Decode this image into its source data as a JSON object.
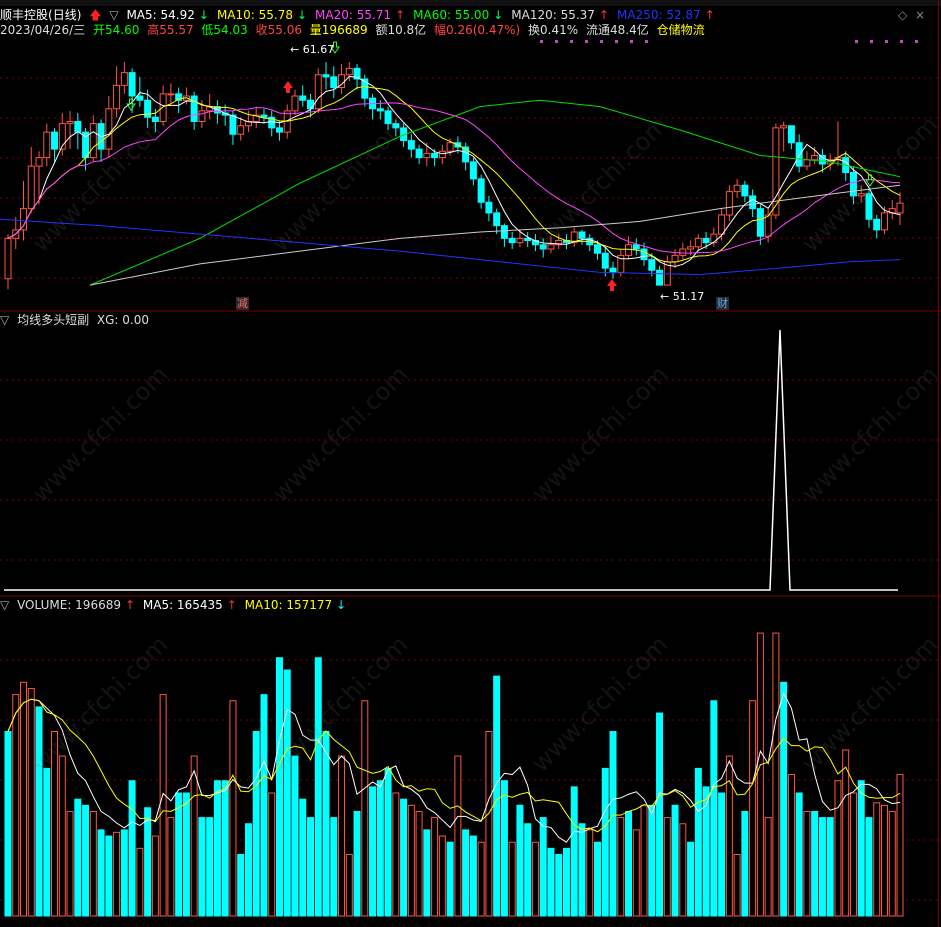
{
  "stock": {
    "name": "顺丰控股",
    "period": "(日线)"
  },
  "ma_line": [
    {
      "label": "MA5: 54.92",
      "arrow": "↓",
      "color": "#ffffff",
      "arrow_color": "#00ff66"
    },
    {
      "label": "MA10: 55.78",
      "arrow": "↓",
      "color": "#ffff00",
      "arrow_color": "#00ff66"
    },
    {
      "label": "MA20: 55.71",
      "arrow": "↑",
      "color": "#ff44ff",
      "arrow_color": "#ff3333"
    },
    {
      "label": "MA60: 55.00",
      "arrow": "↓",
      "color": "#00ff00",
      "arrow_color": "#00ff66"
    },
    {
      "label": "MA120: 55.37",
      "arrow": "↑",
      "color": "#dddddd",
      "arrow_color": "#ff3333"
    },
    {
      "label": "MA250: 52.87",
      "arrow": "↑",
      "color": "#2233ff",
      "arrow_color": "#ff3333"
    }
  ],
  "quote": {
    "date": "2023/04/26/三",
    "open": "开54.60",
    "high": "高55.57",
    "low": "低54.03",
    "close": "收55.06",
    "volume": "量196689",
    "amount": "额10.8亿",
    "change": "幅0.26(0.47%)",
    "turnover": "换0.41%",
    "float": "流通48.4亿",
    "sector": "仓储物流"
  },
  "annotations": {
    "high": "61.67",
    "low": "51.17",
    "marker1": "减",
    "marker2": "财"
  },
  "indicator": {
    "title": "均线多头短副",
    "xg": "XG: 0.00"
  },
  "volume_header": {
    "vol": "VOLUME: 196689",
    "ma5": "MA5: 165435",
    "ma10": "MA10: 157177"
  },
  "watermark": "www.cfchi.com",
  "colors": {
    "up": "#ff5544",
    "down": "#00ffff",
    "grid": "#7a0000"
  },
  "candles": [
    [
      51.5,
      53.4,
      51.0,
      53.6
    ],
    [
      53.4,
      53.8,
      52.9,
      54.4
    ],
    [
      53.8,
      54.8,
      53.3,
      56.1
    ],
    [
      54.8,
      56.8,
      54.6,
      57.7
    ],
    [
      56.8,
      57.2,
      55.0,
      57.5
    ],
    [
      57.2,
      58.4,
      56.8,
      58.8
    ],
    [
      58.4,
      57.6,
      57.0,
      58.6
    ],
    [
      57.6,
      58.8,
      57.3,
      59.3
    ],
    [
      58.8,
      58.9,
      57.6,
      59.4
    ],
    [
      58.9,
      58.4,
      57.6,
      59.3
    ],
    [
      58.4,
      57.2,
      56.6,
      58.6
    ],
    [
      57.2,
      58.8,
      57.0,
      59.2
    ],
    [
      58.8,
      57.6,
      57.0,
      59.0
    ],
    [
      57.6,
      59.5,
      57.2,
      60.1
    ],
    [
      59.5,
      60.6,
      59.1,
      61.5
    ],
    [
      60.6,
      61.2,
      60.2,
      61.7
    ],
    [
      61.2,
      60.1,
      59.3,
      61.4
    ],
    [
      60.1,
      59.9,
      59.6,
      61.0
    ],
    [
      59.9,
      59.1,
      58.6,
      60.4
    ],
    [
      59.1,
      58.9,
      58.4,
      59.5
    ],
    [
      58.9,
      60.2,
      58.7,
      60.6
    ],
    [
      60.2,
      60.2,
      59.7,
      60.7
    ],
    [
      60.2,
      59.9,
      59.3,
      60.5
    ],
    [
      59.9,
      60.1,
      59.7,
      60.5
    ],
    [
      60.1,
      58.9,
      58.5,
      60.3
    ],
    [
      58.9,
      59.4,
      58.6,
      59.9
    ],
    [
      59.4,
      59.6,
      59.0,
      60.2
    ],
    [
      59.6,
      59.3,
      58.8,
      59.9
    ],
    [
      59.3,
      59.2,
      58.7,
      59.7
    ],
    [
      59.2,
      58.3,
      57.8,
      59.4
    ],
    [
      58.3,
      58.7,
      58.0,
      59.1
    ],
    [
      58.7,
      58.9,
      58.4,
      59.4
    ],
    [
      58.9,
      59.2,
      58.6,
      59.6
    ],
    [
      59.2,
      59.1,
      58.8,
      59.5
    ],
    [
      59.1,
      58.6,
      58.2,
      59.4
    ],
    [
      58.6,
      58.4,
      58.0,
      58.9
    ],
    [
      58.4,
      59.4,
      58.1,
      59.7
    ],
    [
      59.4,
      60.1,
      59.2,
      60.4
    ],
    [
      60.1,
      59.9,
      59.6,
      60.6
    ],
    [
      59.9,
      59.5,
      59.1,
      60.2
    ],
    [
      59.5,
      61.1,
      59.3,
      61.4
    ],
    [
      61.1,
      61.0,
      60.4,
      61.7
    ],
    [
      61.0,
      60.5,
      60.0,
      61.5
    ],
    [
      60.5,
      61.1,
      60.2,
      61.6
    ],
    [
      61.1,
      61.4,
      60.8,
      61.7
    ],
    [
      61.4,
      60.9,
      60.4,
      61.6
    ],
    [
      60.9,
      60.0,
      59.6,
      61.1
    ],
    [
      60.0,
      59.5,
      59.0,
      60.2
    ],
    [
      59.5,
      59.4,
      59.0,
      59.9
    ],
    [
      59.4,
      58.8,
      58.5,
      59.6
    ],
    [
      58.8,
      58.6,
      58.2,
      59.0
    ],
    [
      58.6,
      58.0,
      57.7,
      58.8
    ],
    [
      58.0,
      57.6,
      57.2,
      58.3
    ],
    [
      57.6,
      57.2,
      56.9,
      57.8
    ],
    [
      57.2,
      57.4,
      56.8,
      57.9
    ],
    [
      57.4,
      57.2,
      56.8,
      57.6
    ],
    [
      57.2,
      57.5,
      56.9,
      57.8
    ],
    [
      57.5,
      57.9,
      57.3,
      58.1
    ],
    [
      57.9,
      57.7,
      57.4,
      58.2
    ],
    [
      57.7,
      57.0,
      56.6,
      57.9
    ],
    [
      57.0,
      56.2,
      55.9,
      57.2
    ],
    [
      56.2,
      55.1,
      54.8,
      56.4
    ],
    [
      55.1,
      54.6,
      54.2,
      55.4
    ],
    [
      54.6,
      54.0,
      53.6,
      54.8
    ],
    [
      54.0,
      53.4,
      53.0,
      54.1
    ],
    [
      53.4,
      53.2,
      52.9,
      53.7
    ],
    [
      53.2,
      53.4,
      53.0,
      53.8
    ],
    [
      53.4,
      53.3,
      53.0,
      53.7
    ],
    [
      53.3,
      53.1,
      52.8,
      53.6
    ],
    [
      53.1,
      52.9,
      52.5,
      53.4
    ],
    [
      52.9,
      53.1,
      52.7,
      53.5
    ],
    [
      53.1,
      53.3,
      52.9,
      53.6
    ],
    [
      53.3,
      53.2,
      52.9,
      53.6
    ],
    [
      53.2,
      53.7,
      53.0,
      53.9
    ],
    [
      53.7,
      53.4,
      53.1,
      53.8
    ],
    [
      53.4,
      53.1,
      52.8,
      53.6
    ],
    [
      53.1,
      52.7,
      52.4,
      53.3
    ],
    [
      52.7,
      52.0,
      51.6,
      53.0
    ],
    [
      52.0,
      51.8,
      51.5,
      52.3
    ],
    [
      51.8,
      52.6,
      51.6,
      52.9
    ],
    [
      52.6,
      53.1,
      52.4,
      53.5
    ],
    [
      53.1,
      52.9,
      52.6,
      53.4
    ],
    [
      52.9,
      52.4,
      52.1,
      53.2
    ],
    [
      52.4,
      51.9,
      51.6,
      52.7
    ],
    [
      51.9,
      51.2,
      51.2,
      52.1
    ],
    [
      51.2,
      52.3,
      51.2,
      52.6
    ],
    [
      52.3,
      52.6,
      52.0,
      52.9
    ],
    [
      52.6,
      52.9,
      52.4,
      53.2
    ],
    [
      52.9,
      53.0,
      52.6,
      53.3
    ],
    [
      53.0,
      53.4,
      52.8,
      53.6
    ],
    [
      53.4,
      53.2,
      52.9,
      53.7
    ],
    [
      53.2,
      53.6,
      53.0,
      53.9
    ],
    [
      53.6,
      54.5,
      53.3,
      54.8
    ],
    [
      54.5,
      55.6,
      54.2,
      55.9
    ],
    [
      55.6,
      55.9,
      55.3,
      56.2
    ],
    [
      55.9,
      55.4,
      55.1,
      56.1
    ],
    [
      55.4,
      54.8,
      54.4,
      55.7
    ],
    [
      54.8,
      53.5,
      53.1,
      55.0
    ],
    [
      53.5,
      54.5,
      53.2,
      54.8
    ],
    [
      54.5,
      58.6,
      54.3,
      58.8
    ],
    [
      58.6,
      58.7,
      57.5,
      58.9
    ],
    [
      58.7,
      57.9,
      57.6,
      58.4
    ],
    [
      57.9,
      56.8,
      56.5,
      58.3
    ],
    [
      56.8,
      57.1,
      56.6,
      57.5
    ],
    [
      57.1,
      57.3,
      56.9,
      57.7
    ],
    [
      57.3,
      56.9,
      56.5,
      57.6
    ],
    [
      56.9,
      57.1,
      56.6,
      57.4
    ],
    [
      57.1,
      57.2,
      56.8,
      58.9
    ],
    [
      57.2,
      56.5,
      56.1,
      57.5
    ],
    [
      56.5,
      55.4,
      55.0,
      56.8
    ],
    [
      55.4,
      55.5,
      55.1,
      55.9
    ],
    [
      55.5,
      54.3,
      53.9,
      55.7
    ],
    [
      54.3,
      53.8,
      53.4,
      54.5
    ],
    [
      53.8,
      54.6,
      53.6,
      54.9
    ],
    [
      54.6,
      54.8,
      54.3,
      55.2
    ],
    [
      54.6,
      55.06,
      54.03,
      55.57
    ]
  ],
  "volumes": [
    [
      150,
      "d"
    ],
    [
      180,
      "u"
    ],
    [
      190,
      "u"
    ],
    [
      185,
      "u"
    ],
    [
      170,
      "d"
    ],
    [
      120,
      "d"
    ],
    [
      150,
      "u"
    ],
    [
      130,
      "u"
    ],
    [
      85,
      "u"
    ],
    [
      95,
      "d"
    ],
    [
      90,
      "d"
    ],
    [
      85,
      "u"
    ],
    [
      70,
      "d"
    ],
    [
      65,
      "d"
    ],
    [
      68,
      "u"
    ],
    [
      70,
      "d"
    ],
    [
      110,
      "d"
    ],
    [
      55,
      "u"
    ],
    [
      88,
      "d"
    ],
    [
      65,
      "u"
    ],
    [
      180,
      "u"
    ],
    [
      80,
      "u"
    ],
    [
      100,
      "d"
    ],
    [
      100,
      "d"
    ],
    [
      130,
      "u"
    ],
    [
      80,
      "d"
    ],
    [
      80,
      "d"
    ],
    [
      110,
      "d"
    ],
    [
      110,
      "d"
    ],
    [
      175,
      "u"
    ],
    [
      50,
      "d"
    ],
    [
      75,
      "d"
    ],
    [
      150,
      "d"
    ],
    [
      180,
      "d"
    ],
    [
      100,
      "u"
    ],
    [
      210,
      "d"
    ],
    [
      200,
      "d"
    ],
    [
      130,
      "d"
    ],
    [
      95,
      "d"
    ],
    [
      80,
      "d"
    ],
    [
      210,
      "d"
    ],
    [
      150,
      "d"
    ],
    [
      80,
      "d"
    ],
    [
      130,
      "u"
    ],
    [
      50,
      "u"
    ],
    [
      85,
      "d"
    ],
    [
      175,
      "u"
    ],
    [
      105,
      "d"
    ],
    [
      110,
      "d"
    ],
    [
      120,
      "d"
    ],
    [
      100,
      "u"
    ],
    [
      95,
      "d"
    ],
    [
      90,
      "u"
    ],
    [
      85,
      "u"
    ],
    [
      70,
      "d"
    ],
    [
      80,
      "u"
    ],
    [
      65,
      "u"
    ],
    [
      60,
      "d"
    ],
    [
      130,
      "u"
    ],
    [
      70,
      "d"
    ],
    [
      65,
      "d"
    ],
    [
      60,
      "u"
    ],
    [
      150,
      "u"
    ],
    [
      195,
      "d"
    ],
    [
      110,
      "d"
    ],
    [
      60,
      "u"
    ],
    [
      90,
      "d"
    ],
    [
      75,
      "d"
    ],
    [
      60,
      "u"
    ],
    [
      80,
      "d"
    ],
    [
      55,
      "d"
    ],
    [
      50,
      "d"
    ],
    [
      55,
      "d"
    ],
    [
      105,
      "d"
    ],
    [
      75,
      "d"
    ],
    [
      70,
      "u"
    ],
    [
      60,
      "d"
    ],
    [
      120,
      "d"
    ],
    [
      150,
      "d"
    ],
    [
      80,
      "u"
    ],
    [
      85,
      "d"
    ],
    [
      70,
      "u"
    ],
    [
      90,
      "u"
    ],
    [
      90,
      "d"
    ],
    [
      165,
      "d"
    ],
    [
      80,
      "u"
    ],
    [
      90,
      "d"
    ],
    [
      75,
      "u"
    ],
    [
      60,
      "d"
    ],
    [
      120,
      "d"
    ],
    [
      105,
      "d"
    ],
    [
      175,
      "d"
    ],
    [
      100,
      "d"
    ],
    [
      130,
      "u"
    ],
    [
      50,
      "u"
    ],
    [
      85,
      "d"
    ],
    [
      175,
      "u"
    ],
    [
      230,
      "u"
    ],
    [
      80,
      "u"
    ],
    [
      230,
      "u"
    ],
    [
      190,
      "d"
    ],
    [
      115,
      "u"
    ],
    [
      100,
      "d"
    ],
    [
      85,
      "u"
    ],
    [
      85,
      "d"
    ],
    [
      80,
      "d"
    ],
    [
      80,
      "d"
    ],
    [
      110,
      "u"
    ],
    [
      135,
      "u"
    ],
    [
      100,
      "u"
    ],
    [
      110,
      "d"
    ],
    [
      80,
      "d"
    ],
    [
      92,
      "u"
    ],
    [
      90,
      "u"
    ],
    [
      85,
      "u"
    ],
    [
      115,
      "u"
    ]
  ]
}
